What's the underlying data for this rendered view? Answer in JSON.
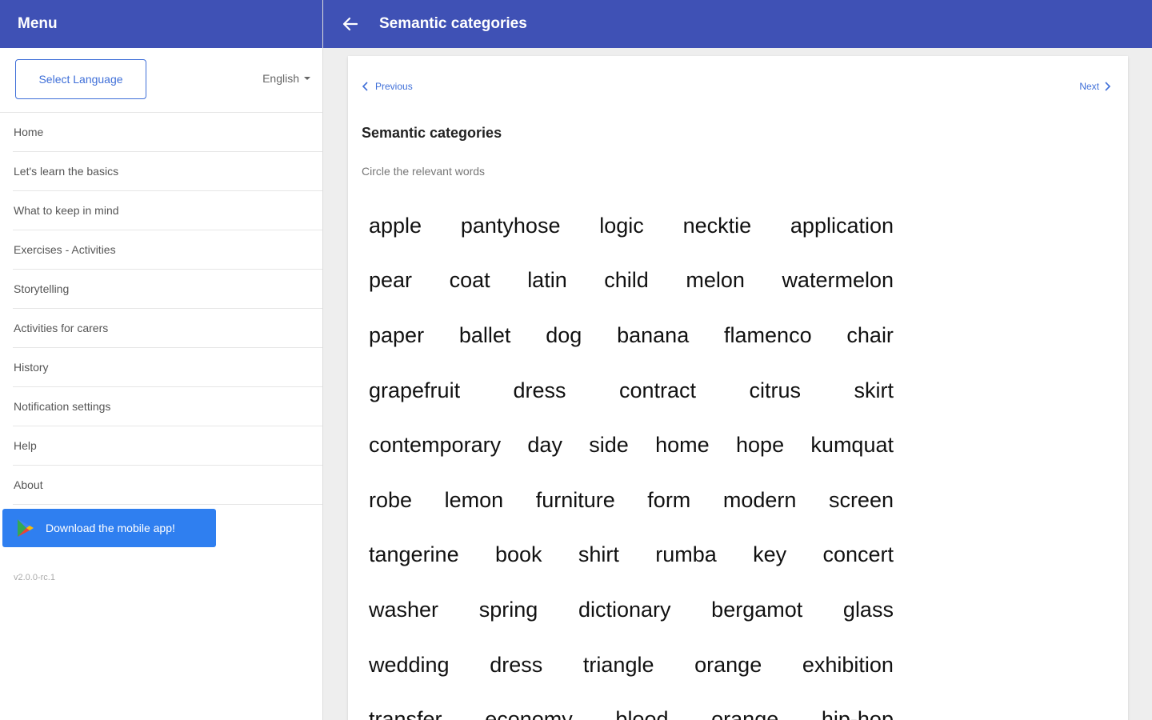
{
  "sidebar": {
    "title": "Menu",
    "select_language_label": "Select Language",
    "language_value": "English",
    "items": [
      {
        "label": "Home"
      },
      {
        "label": "Let's learn the basics"
      },
      {
        "label": "What to keep in mind"
      },
      {
        "label": "Exercises - Activities"
      },
      {
        "label": "Storytelling"
      },
      {
        "label": "Activities for carers"
      },
      {
        "label": "History"
      },
      {
        "label": "Notification settings"
      },
      {
        "label": "Help"
      },
      {
        "label": "About"
      }
    ],
    "download_label": "Download the mobile app!",
    "version": "v2.0.0-rc.1"
  },
  "header": {
    "title": "Semantic categories"
  },
  "content": {
    "prev_label": "Previous",
    "next_label": "Next",
    "title": "Semantic categories",
    "instruction": "Circle the relevant words",
    "rows": [
      [
        "apple",
        "pantyhose",
        "logic",
        "necktie",
        "application"
      ],
      [
        "pear",
        "coat",
        "latin",
        "child",
        "melon",
        "watermelon"
      ],
      [
        "paper",
        "ballet",
        "dog",
        "banana",
        "flamenco",
        "chair"
      ],
      [
        "grapefruit",
        "dress",
        "contract",
        "citrus",
        "skirt"
      ],
      [
        "contemporary",
        "day",
        "side",
        "home",
        "hope",
        "kumquat"
      ],
      [
        "robe",
        "lemon",
        "furniture",
        "form",
        "modern",
        "screen"
      ],
      [
        "tangerine",
        "book",
        "shirt",
        "rumba",
        "key",
        "concert"
      ],
      [
        "washer",
        "spring",
        "dictionary",
        "bergamot",
        "glass"
      ],
      [
        "wedding",
        "dress",
        "triangle",
        "orange",
        "exhibition"
      ],
      [
        "transfer",
        "economy",
        "blood",
        "orange",
        "hip-hop"
      ]
    ]
  },
  "colors": {
    "primary": "#3f51b5",
    "accent": "#2f7ff0",
    "link": "#3f6fd8",
    "background": "#eeeeee"
  },
  "icons": {
    "back": "arrow-left-icon",
    "prev": "chevron-left-icon",
    "next": "chevron-right-icon",
    "store": "google-play-icon",
    "dropdown": "caret-down-icon"
  }
}
